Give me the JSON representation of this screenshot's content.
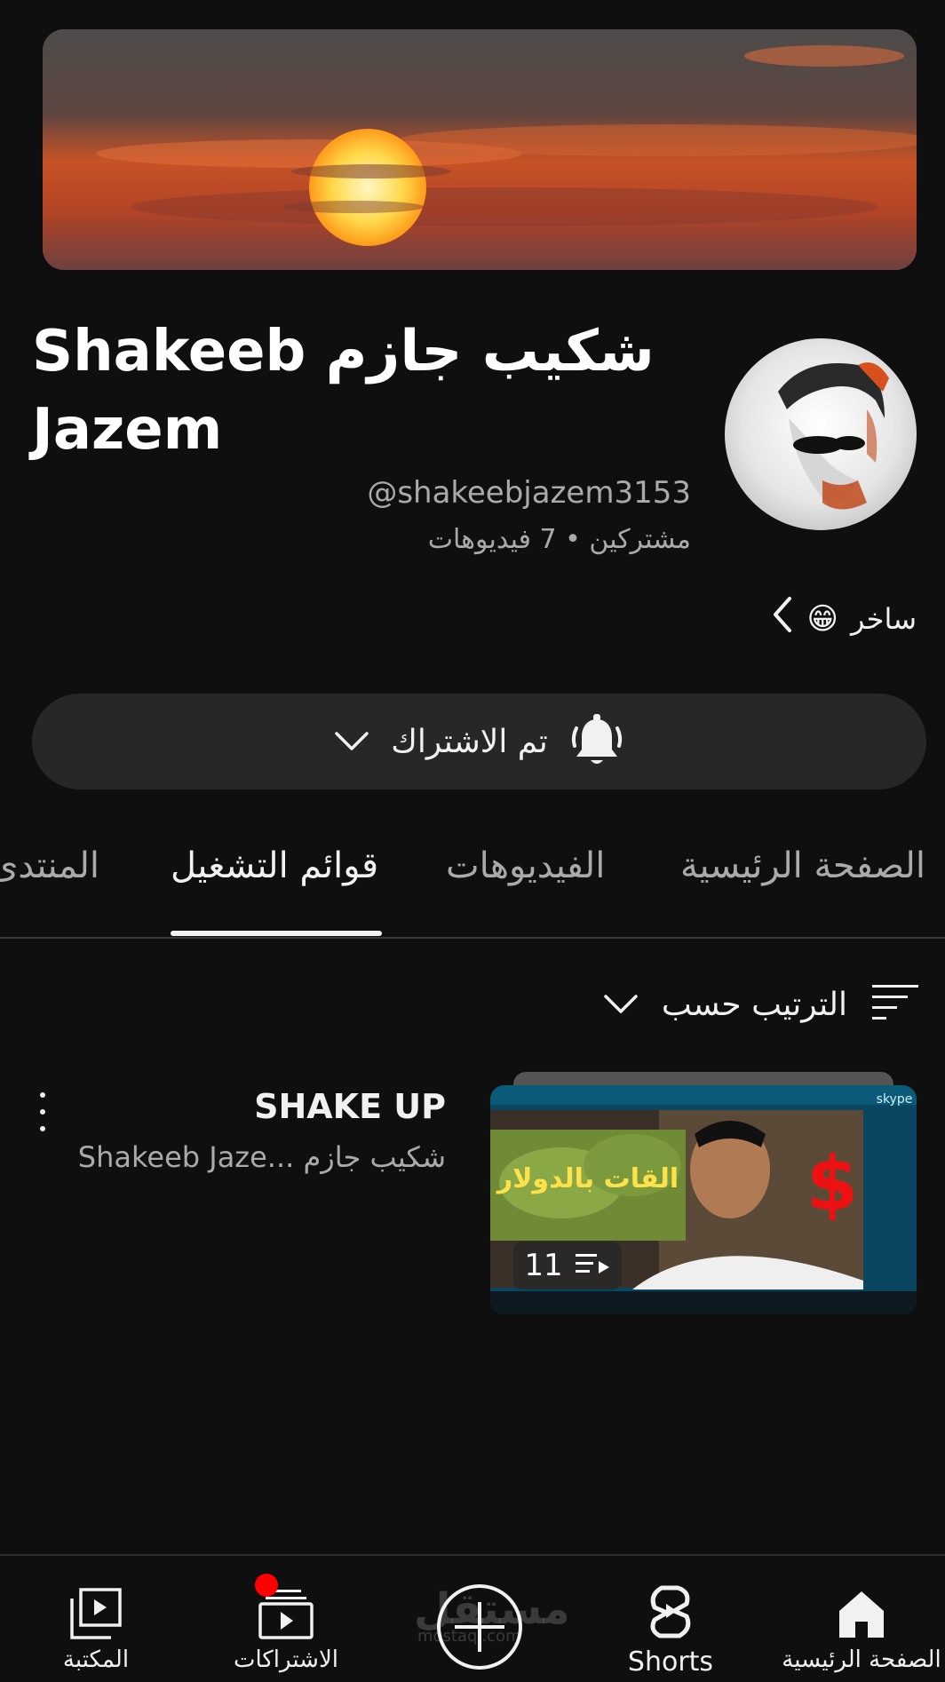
{
  "channel": {
    "title": "شكيب جازم Shakeeb Jazem",
    "handle": "@shakeebjazem3153",
    "stats": "مشتركين • 7 فيديوهات",
    "about": "ساخر",
    "about_emoji": "😁"
  },
  "subscribe": {
    "label": "تم الاشتراك"
  },
  "tabs": [
    {
      "label": "الصفحة الرئيسية",
      "active": false
    },
    {
      "label": "الفيديوهات",
      "active": false
    },
    {
      "label": "قوائم التشغيل",
      "active": true
    },
    {
      "label": "المنتدى",
      "active": false
    }
  ],
  "sort": {
    "label": "الترتيب حسب"
  },
  "playlists": [
    {
      "title": "SHAKE UP",
      "owner": "شكيب جازم ...Shakeeb Jaze",
      "video_count": "11",
      "thumb_text": "القات بالدولار",
      "thumb_symbol": "$",
      "thumb_badge": "skype"
    }
  ],
  "bottom_nav": [
    {
      "label": "الصفحة الرئيسية",
      "icon": "home-icon"
    },
    {
      "label": "Shorts",
      "icon": "shorts-icon"
    },
    {
      "label": "",
      "icon": "create-icon"
    },
    {
      "label": "الاشتراكات",
      "icon": "subscriptions-icon",
      "has_notification_dot": true
    },
    {
      "label": "المكتبة",
      "icon": "library-icon"
    }
  ],
  "watermark": {
    "text": "مستقل",
    "sub": "mostaql.com"
  },
  "colors": {
    "background": "#0f0f0f",
    "surface": "#272727",
    "text_primary": "#f1f1f1",
    "text_secondary": "#aaaaaa",
    "notification_red": "#ff0000"
  }
}
